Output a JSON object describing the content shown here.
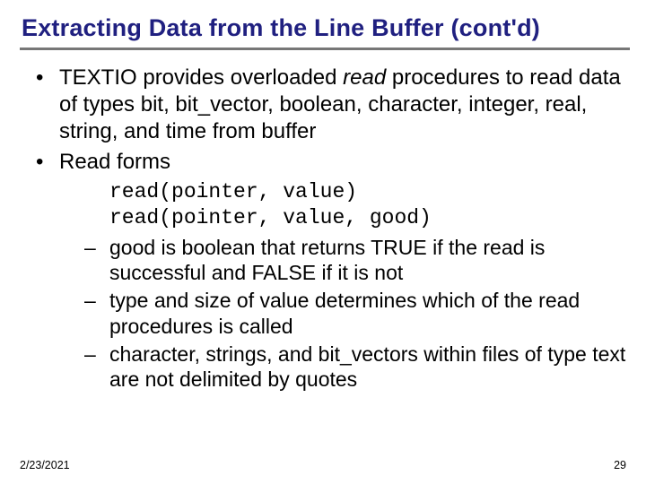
{
  "title": "Extracting Data from the Line Buffer (cont'd)",
  "bullets": {
    "b1_pre": "TEXTIO provides overloaded ",
    "b1_em": "read",
    "b1_post": " procedures to read data of types bit, bit_vector, boolean, character, integer, real, string, and time from buffer",
    "b2": "Read forms"
  },
  "code": {
    "line1": "read(pointer, value)",
    "line2": "read(pointer, value, good)"
  },
  "sub": {
    "s1": "good is boolean that returns TRUE if the read is successful and FALSE if it is not",
    "s2": "type and size of value determines which of the read procedures is called",
    "s3": "character, strings, and bit_vectors within files of type text are not delimited by quotes"
  },
  "footer": {
    "date": "2/23/2021",
    "page": "29"
  }
}
